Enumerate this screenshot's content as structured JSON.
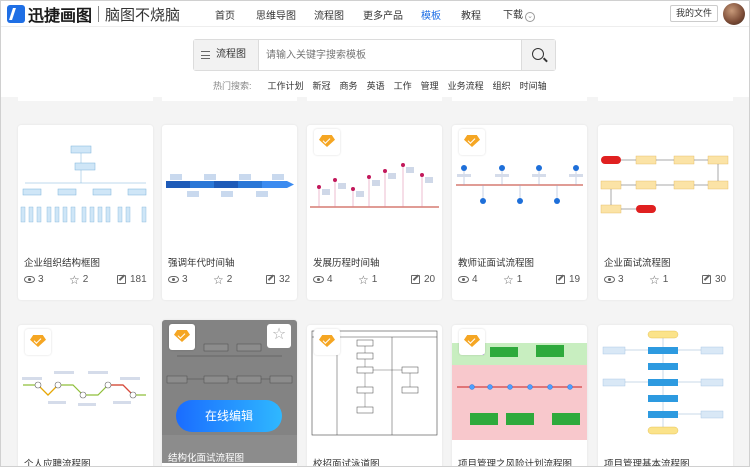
{
  "header": {
    "logo_text": "迅捷画图",
    "logo_sub": "脑图不烧脑",
    "nav": [
      "首页",
      "思维导图",
      "流程图",
      "更多产品",
      "模板",
      "教程",
      "下载"
    ],
    "active_nav": "模板",
    "my_files": "我的文件"
  },
  "search": {
    "category": "流程图",
    "placeholder": "请输入关键字搜索模板",
    "hot_label": "热门搜索:",
    "hot_tags": [
      "工作计划",
      "新冠",
      "商务",
      "英语",
      "工作",
      "管理",
      "业务流程",
      "组织",
      "时间轴"
    ]
  },
  "cards": [
    {
      "title": "企业组织结构框图",
      "views": "3",
      "stars": "2",
      "edits": "181",
      "vip": false
    },
    {
      "title": "强调年代时间轴",
      "views": "3",
      "stars": "2",
      "edits": "32",
      "vip": false
    },
    {
      "title": "发展历程时间轴",
      "views": "4",
      "stars": "1",
      "edits": "20",
      "vip": true
    },
    {
      "title": "教师证面试流程图",
      "views": "4",
      "stars": "1",
      "edits": "19",
      "vip": true
    },
    {
      "title": "企业面试流程图",
      "views": "3",
      "stars": "1",
      "edits": "30",
      "vip": false
    },
    {
      "title": "个人应聘流程图",
      "vip": true
    },
    {
      "title": "结构化面试流程图",
      "vip": true,
      "hover_button": "在线编辑"
    },
    {
      "title": "校招面试泳道图",
      "vip": true
    },
    {
      "title": "项目管理之风险计划流程图",
      "vip": true
    },
    {
      "title": "项目管理基本流程图",
      "vip": false
    }
  ],
  "colors": {
    "accent": "#1f6fe5",
    "vip": "#f5a623"
  }
}
